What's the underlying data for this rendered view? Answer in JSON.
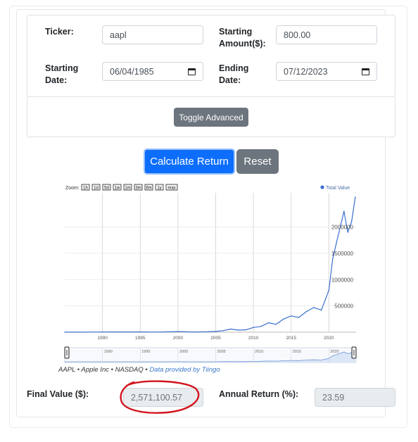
{
  "form": {
    "ticker_label": "Ticker:",
    "ticker_value": "aapl",
    "amount_label_line1": "Starting",
    "amount_label_line2": "Amount($):",
    "amount_value": "800.00",
    "start_label_line1": "Starting",
    "start_label_line2": "Date:",
    "start_value": "06/04/1985",
    "end_label_line1": "Ending",
    "end_label_line2": "Date:",
    "end_value": "07/12/2023"
  },
  "advanced": {
    "toggle_label": "Toggle Advanced"
  },
  "actions": {
    "calculate_label": "Calculate Return",
    "reset_label": "Reset"
  },
  "chart": {
    "zoom_label": "Zoom:",
    "zoom_buttons": [
      "1h",
      "1d",
      "5d",
      "1w",
      "1m",
      "3m",
      "6m",
      "1y",
      "max"
    ],
    "legend_label": "Total Value",
    "caption_prefix": "AAPL • Apple Inc • NASDAQ • ",
    "caption_link": "Data provided by Tiingo"
  },
  "chart_data": {
    "type": "line",
    "title": "",
    "xlabel": "",
    "ylabel": "",
    "series": [
      {
        "name": "Total Value",
        "x": [
          1985,
          1987,
          1990,
          1992,
          1995,
          1997,
          2000,
          2002,
          2004,
          2005,
          2006,
          2007,
          2008,
          2009,
          2010,
          2011,
          2012,
          2013,
          2014,
          2015,
          2016,
          2017,
          2018,
          2019,
          2020,
          2020.5,
          2021,
          2021.5,
          2022,
          2022.5,
          2023,
          2023.5
        ],
        "values": [
          800,
          2000,
          4000,
          5000,
          6000,
          3000,
          12000,
          4000,
          8000,
          15000,
          30000,
          60000,
          40000,
          45000,
          90000,
          110000,
          180000,
          150000,
          250000,
          310000,
          280000,
          390000,
          470000,
          420000,
          800000,
          1400000,
          1700000,
          2000000,
          2300000,
          1900000,
          2100000,
          2571100
        ]
      }
    ],
    "x_ticks": [
      "1990",
      "1995",
      "2000",
      "2005",
      "2010",
      "2015",
      "2020"
    ],
    "y_ticks": [
      "500000",
      "1000000",
      "1500000",
      "2000000"
    ],
    "navigator_ticks": [
      "1990",
      "1995",
      "2000",
      "2005",
      "2010",
      "2015",
      "2020"
    ],
    "xlim": [
      1985,
      2023.6
    ],
    "ylim": [
      0,
      2650000
    ],
    "grid": true,
    "legend_position": "top-right",
    "color": "#3a6fcf"
  },
  "results": {
    "final_label": "Final Value ($):",
    "final_value": "2,571,100.57",
    "annual_label": "Annual Return (%):",
    "annual_value": "23.59"
  },
  "colors": {
    "primary": "#0d6efd",
    "secondary": "#6c757d",
    "annotation": "#d2141e"
  }
}
